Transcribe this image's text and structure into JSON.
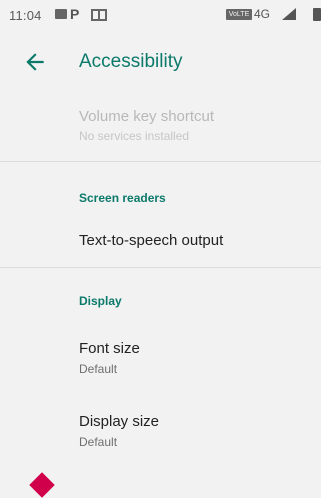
{
  "status_bar": {
    "time": "11:04",
    "network_label": "4G",
    "volte_label": "VoLTE",
    "icons": [
      "message-icon",
      "p-app-icon",
      "screen-icon",
      "volte-icon",
      "signal-icon",
      "battery-icon"
    ]
  },
  "app_bar": {
    "title": "Accessibility",
    "back_icon": "back-arrow-icon"
  },
  "items": [
    {
      "title": "Volume key shortcut",
      "subtitle": "No services installed",
      "disabled": true
    }
  ],
  "sections": [
    {
      "header": "Screen readers",
      "items": [
        {
          "title": "Text-to-speech output"
        }
      ]
    },
    {
      "header": "Display",
      "items": [
        {
          "title": "Font size",
          "subtitle": "Default"
        },
        {
          "title": "Display size",
          "subtitle": "Default"
        }
      ]
    }
  ],
  "colors": {
    "accent": "#0b7a6b",
    "background": "#f2f2f2",
    "partial_icon": "#d1004a"
  }
}
